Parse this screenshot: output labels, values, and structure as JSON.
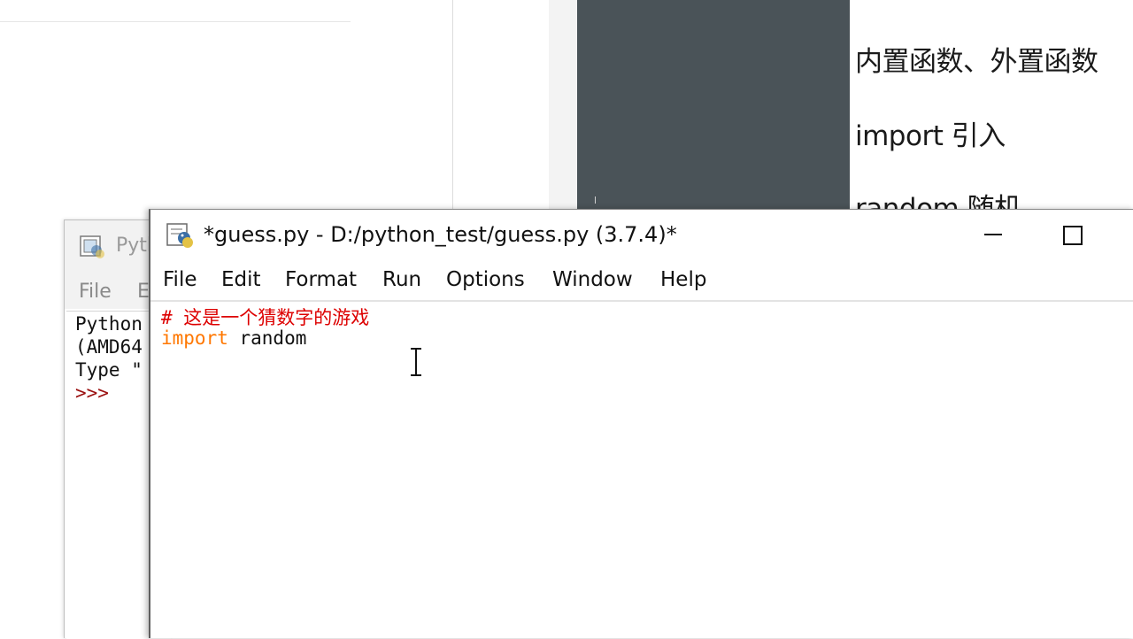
{
  "notes": {
    "lines": [
      "内置函数、外置函数",
      "import 引入",
      "random 随机"
    ]
  },
  "shell_window": {
    "title": "Pyth",
    "menu": [
      "File",
      "E"
    ],
    "output": [
      "Python",
      "(AMD64",
      "Type \"",
      ">>>"
    ]
  },
  "editor_window": {
    "title": "*guess.py - D:/python_test/guess.py (3.7.4)*",
    "menu": [
      "File",
      "Edit",
      "Format",
      "Run",
      "Options",
      "Window",
      "Help"
    ],
    "code": {
      "comment_line": "# 这是一个猜数字的游戏",
      "import_keyword": "import",
      "import_module": " random"
    },
    "icons": {
      "app": "python-idle-icon",
      "minimize": "minimize-icon",
      "maximize": "maximize-icon",
      "cursor": "text-cursor-icon"
    }
  },
  "colors": {
    "comment": "#dd0000",
    "keyword": "#ff7700",
    "prompt": "#9b1010",
    "dark_panel": "#4a5358"
  }
}
